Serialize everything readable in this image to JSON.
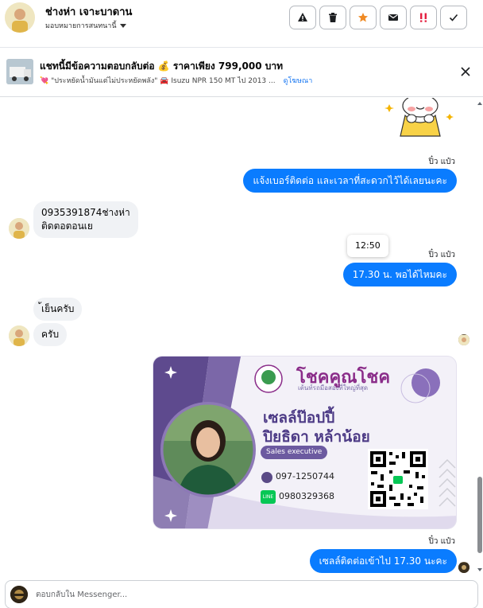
{
  "header": {
    "name": "ช่างห่า เจาะบาดาน",
    "assign_label": "มอบหมายการสนทนานี้",
    "actions": [
      {
        "icon": "warning-icon"
      },
      {
        "icon": "trash-icon"
      },
      {
        "icon": "star-icon"
      },
      {
        "icon": "mail-icon"
      },
      {
        "icon": "important-icon"
      },
      {
        "icon": "check-icon"
      }
    ]
  },
  "ad": {
    "title": "แชทนี้มีข้อความตอบกลับต่อ 💰 ราคาเพียง 799,000 บาท",
    "subtitle": "💘 \"ประหยัดน้ำมันแต่ไม่ประหยัดพลัง\" 🚘 Isuzu NPR 150 MT ไป 2013 ...",
    "link": "ดูโฆษณา"
  },
  "messages": {
    "out1_sender": "ปิ๋ว แป๋ว",
    "out1_text": "แจ้งเบอร์ติดต่อ  และเวลาที่สะดวกไว้ได้เลยนะคะ",
    "in1_line1": "0935391874ช่างห่า",
    "in1_line2": "ติดตอตอนเย",
    "time_tooltip": "12:50",
    "out2_sender": "ปิ๋ว แป๋ว",
    "out2_text": "17.30 น.  พอได้ไหมคะ",
    "in2_text": "้เย็นครับ",
    "in3_text": "ครับ",
    "card": {
      "brand": "โชคคูณโชค",
      "slogan": "เต้นท์รถมือสองที่ใหญ่ที่สุด",
      "name_line1": "เซลล์ป๊อปปี้",
      "name_line2": "ปิยธิดา หล้าน้อย",
      "role": "Sales executive",
      "phone": "097-1250744",
      "line_id": "0980329368",
      "line_badge": "LINE"
    },
    "out3_sender": "ปิ๋ว แป๋ว",
    "out3_text": "เซลล์ติดต่อเข้าไป 17.30  นะคะ"
  },
  "composer": {
    "placeholder": "ตอบกลับใน Messenger..."
  },
  "colors": {
    "accent": "#0a7cff",
    "incoming_bubble": "#f0f2f5",
    "card_purple": "#6c5aa0"
  }
}
